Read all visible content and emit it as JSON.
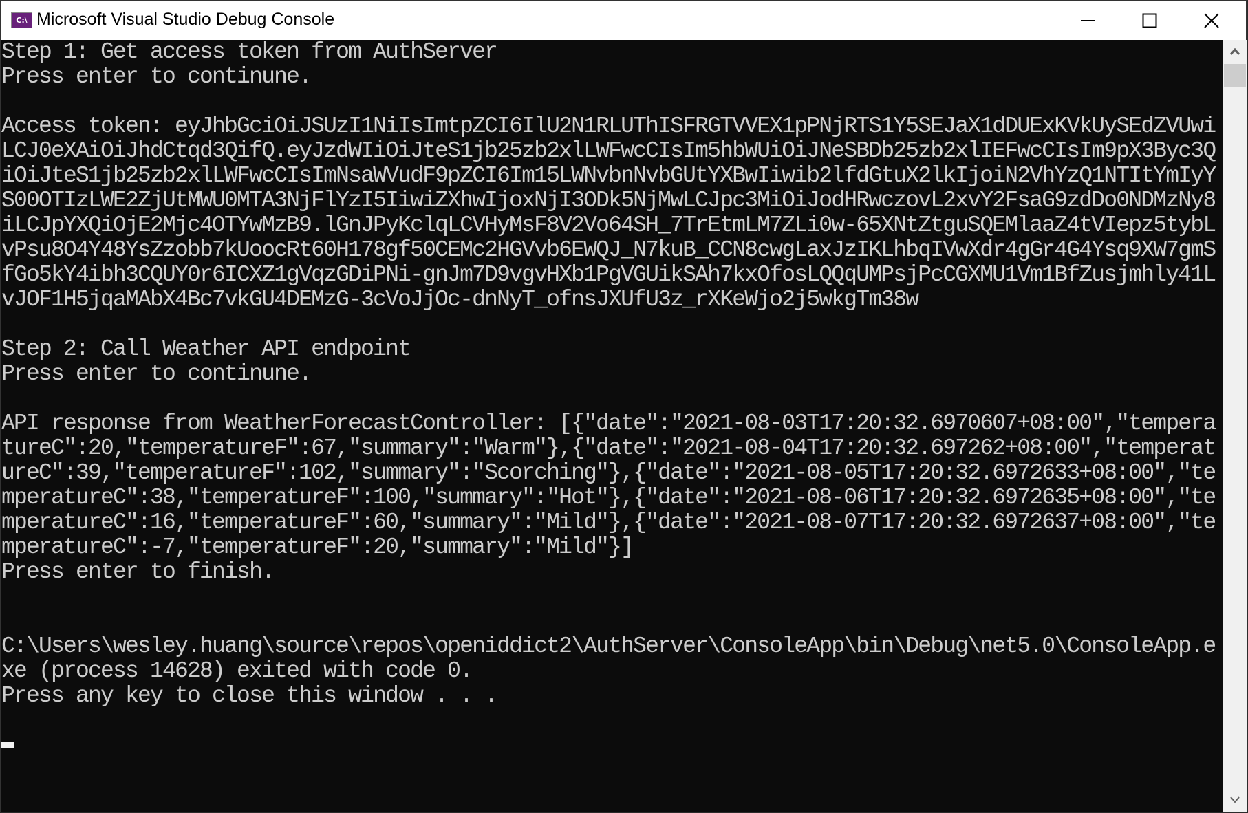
{
  "window": {
    "title": "Microsoft Visual Studio Debug Console",
    "icon": "console-app-icon",
    "icon_text": "C:\\",
    "controls": [
      "minimize-icon",
      "maximize-icon",
      "close-icon"
    ]
  },
  "console": {
    "lines": [
      "Step 1: Get access token from AuthServer",
      "Press enter to continune.",
      "",
      "Access token: eyJhbGciOiJSUzI1NiIsImtpZCI6IlU2N1RLUThISFRGTVVEX1pPNjRTS1Y5SEJaX1dDUExKVkUySEdZVUwi",
      "LCJ0eXAiOiJhdCtqd3QifQ.eyJzdWIiOiJteS1jb25zb2xlLWFwcCIsIm5hbWUiOiJNeSBDb25zb2xlIEFwcCIsIm9pX3Byc3Q",
      "iOiJteS1jb25zb2xlLWFwcCIsImNsaWVudF9pZCI6Im15LWNvbnNvbGUtYXBwIiwib2lfdGtuX2lkIjoiN2VhYzQ1NTItYmIyY",
      "S00OTIzLWE2ZjUtMWU0MTA3NjFlYzI5IiwiZXhwIjoxNjI3ODk5NjMwLCJpc3MiOiJodHRwczovL2xvY2FsaG9zdDo0NDMzNy8",
      "iLCJpYXQiOjE2Mjc4OTYwMzB9.lGnJPyKclqLCVHyMsF8V2Vo64SH_7TrEtmLM7ZLi0w-65XNtZtguSQEMlaaZ4tVIepz5tybL",
      "vPsu8O4Y48YsZzobb7kUoocRt60H178gf50CEMc2HGVvb6EWQJ_N7kuB_CCN8cwgLaxJzIKLhbqIVwXdr4gGr4G4Ysq9XW7gmS",
      "fGo5kY4ibh3CQUY0r6ICXZ1gVqzGDiPNi-gnJm7D9vgvHXb1PgVGUikSAh7kxOfosLQQqUMPsjPcCGXMU1Vm1BfZusjmhly41L",
      "vJOF1H5jqaMAbX4Bc7vkGU4DEMzG-3cVoJjOc-dnNyT_ofnsJXUfU3z_rXKeWjo2j5wkgTm38w",
      "",
      "Step 2: Call Weather API endpoint",
      "Press enter to continune.",
      "",
      "API response from WeatherForecastController: [{\"date\":\"2021-08-03T17:20:32.6970607+08:00\",\"tempera",
      "tureC\":20,\"temperatureF\":67,\"summary\":\"Warm\"},{\"date\":\"2021-08-04T17:20:32.697262+08:00\",\"temperat",
      "ureC\":39,\"temperatureF\":102,\"summary\":\"Scorching\"},{\"date\":\"2021-08-05T17:20:32.6972633+08:00\",\"te",
      "mperatureC\":38,\"temperatureF\":100,\"summary\":\"Hot\"},{\"date\":\"2021-08-06T17:20:32.6972635+08:00\",\"te",
      "mperatureC\":16,\"temperatureF\":60,\"summary\":\"Mild\"},{\"date\":\"2021-08-07T17:20:32.6972637+08:00\",\"te",
      "mperatureC\":-7,\"temperatureF\":20,\"summary\":\"Mild\"}]",
      "Press enter to finish.",
      "",
      "",
      "C:\\Users\\wesley.huang\\source\\repos\\openiddict2\\AuthServer\\ConsoleApp\\bin\\Debug\\net5.0\\ConsoleApp.e",
      "xe (process 14628) exited with code 0.",
      "Press any key to close this window . . .",
      ""
    ]
  },
  "scrollbar": {
    "up_icon": "chevron-up-icon",
    "down_icon": "chevron-down-icon"
  }
}
